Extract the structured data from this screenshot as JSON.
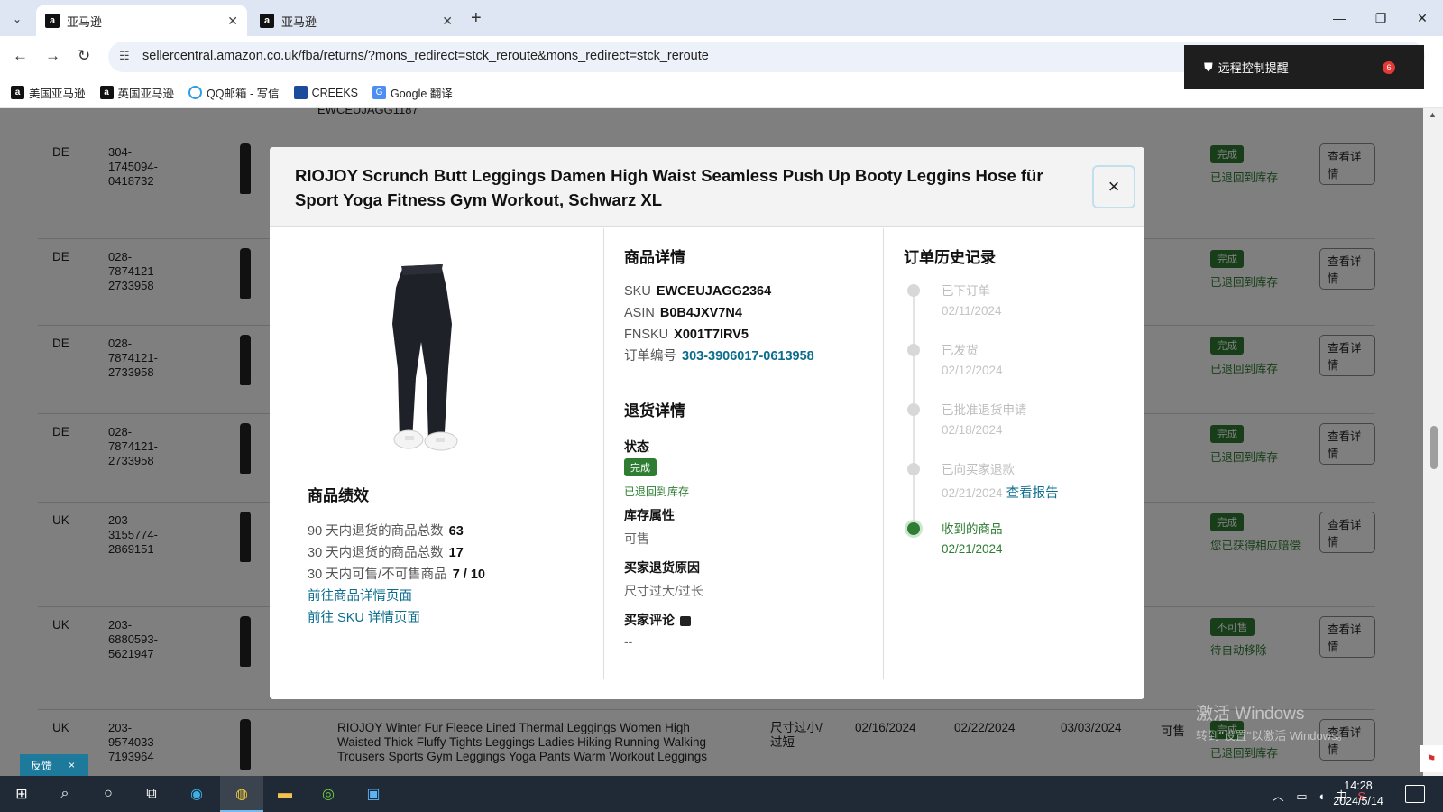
{
  "browser": {
    "tabs": [
      {
        "title": "亚马逊",
        "active": true
      },
      {
        "title": "亚马逊",
        "active": false
      }
    ],
    "url": "sellercentral.amazon.co.uk/fba/returns/?mons_redirect=stck_reroute&mons_redirect=stck_reroute",
    "bookmarks": [
      "美国亚马逊",
      "英国亚马逊",
      "QQ邮箱 - 写信",
      "CREEKS",
      "Google 翻译"
    ],
    "remote_popup": {
      "label": "远程控制提醒",
      "badge": "6"
    }
  },
  "background_rows": {
    "prev_sku": "EWCEUJAGG1187",
    "rows": [
      {
        "market": "DE",
        "order": "304-1745094-0418732",
        "status": "完成",
        "sub": "已退回到库存",
        "btn": "查看详情"
      },
      {
        "market": "DE",
        "order": "028-7874121-2733958",
        "status": "完成",
        "sub": "已退回到库存",
        "btn": "查看详情"
      },
      {
        "market": "DE",
        "order": "028-7874121-2733958",
        "status": "完成",
        "sub": "已退回到库存",
        "btn": "查看详情"
      },
      {
        "market": "DE",
        "order": "028-7874121-2733958",
        "status": "完成",
        "sub": "已退回到库存",
        "btn": "查看详情"
      },
      {
        "market": "UK",
        "order": "203-3155774-2869151",
        "status": "完成",
        "sub": "您已获得相应赔偿",
        "btn": "查看详情"
      },
      {
        "market": "UK",
        "order": "203-6880593-5621947",
        "status": "不可售",
        "sub": "待自动移除",
        "btn": "查看详情"
      },
      {
        "market": "UK",
        "order": "203-9574033-7193964",
        "status": "完成",
        "sub": "已退回到库存",
        "btn": "查看详情",
        "title": "RIOJOY Winter Fur Fleece Lined Thermal Leggings Women High Waisted Thick Fluffy Tights Leggings Ladies Hiking Running Walking Trousers Sports Gym Leggings Yoga Pants Warm Workout Leggings",
        "reason": "尺寸过小/过短",
        "date1": "02/16/2024",
        "date2": "02/22/2024",
        "date3": "03/03/2024",
        "sellable": "可售"
      }
    ]
  },
  "modal": {
    "title": "RIOJOY Scrunch Butt Leggings Damen High Waist Seamless Push Up Booty Leggins Hose für Sport Yoga Fitness Gym Workout, Schwarz XL",
    "close": "×",
    "performance": {
      "title": "商品绩效",
      "rows": [
        {
          "label": "90 天内退货的商品总数",
          "value": "63"
        },
        {
          "label": "30 天内退货的商品总数",
          "value": "17"
        },
        {
          "label": "30 天内可售/不可售商品",
          "value": "7 / 10"
        }
      ],
      "links": [
        "前往商品详情页面",
        "前往 SKU 详情页面"
      ]
    },
    "details": {
      "title": "商品详情",
      "sku_label": "SKU",
      "sku": "EWCEUJAGG2364",
      "asin_label": "ASIN",
      "asin": "B0B4JXV7N4",
      "fnsku_label": "FNSKU",
      "fnsku": "X001T7IRV5",
      "order_label": "订单编号",
      "order": "303-3906017-0613958"
    },
    "returns": {
      "title": "退货详情",
      "status_label": "状态",
      "status_pill": "完成",
      "status_sub": "已退回到库存",
      "inv_label": "库存属性",
      "inv_value": "可售",
      "reason_label": "买家退货原因",
      "reason_value": "尺寸过大/过长",
      "comment_label": "买家评论",
      "comment_value": "--"
    },
    "history": {
      "title": "订单历史记录",
      "steps": [
        {
          "label": "已下订单",
          "date": "02/11/2024",
          "done": false
        },
        {
          "label": "已发货",
          "date": "02/12/2024",
          "done": false
        },
        {
          "label": "已批准退货申请",
          "date": "02/18/2024",
          "done": false
        },
        {
          "label": "已向买家退款",
          "date": "02/21/2024",
          "done": false,
          "link": "查看报告"
        },
        {
          "label": "收到的商品",
          "date": "02/21/2024",
          "done": true
        }
      ]
    }
  },
  "feedback": {
    "label": "反馈",
    "close": "×"
  },
  "watermark": {
    "line1": "激活 Windows",
    "line2": "转到\"设置\"以激活 Windows。"
  },
  "taskbar": {
    "time": "14:28",
    "date": "2024/5/14",
    "ime": "中"
  }
}
